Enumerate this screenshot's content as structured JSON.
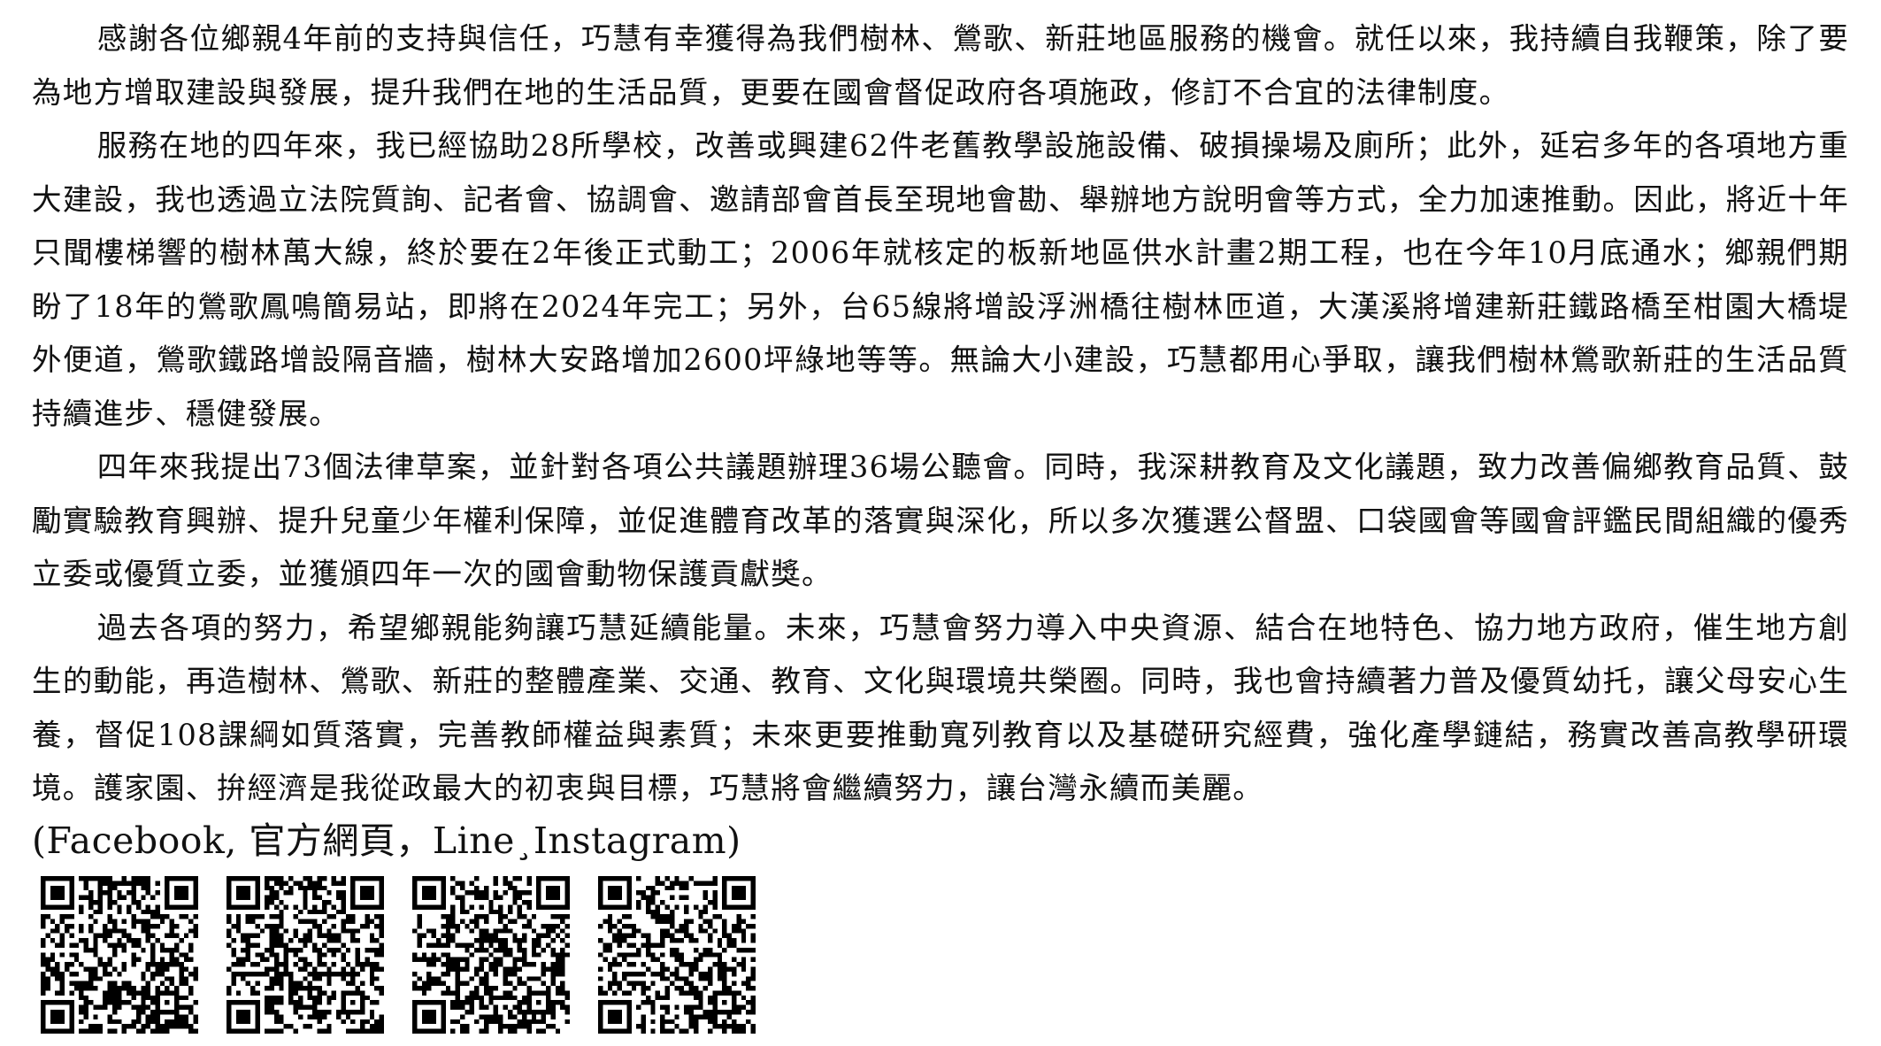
{
  "paragraphs": [
    "感謝各位鄉親4年前的支持與信任，巧慧有幸獲得為我們樹林、鶯歌、新莊地區服務的機會。就任以來，我持續自我鞭策，除了要為地方增取建設與發展，提升我們在地的生活品質，更要在國會督促政府各項施政，修訂不合宜的法律制度。",
    "服務在地的四年來，我已經協助28所學校，改善或興建62件老舊教學設施設備、破損操場及廁所；此外，延宕多年的各項地方重大建設，我也透過立法院質詢、記者會、協調會、邀請部會首長至現地會勘、舉辦地方說明會等方式，全力加速推動。因此，將近十年只聞樓梯響的樹林萬大線，終於要在2年後正式動工；2006年就核定的板新地區供水計畫2期工程，也在今年10月底通水；鄉親們期盼了18年的鶯歌鳳鳴簡易站，即將在2024年完工；另外，台65線將增設浮洲橋往樹林匝道，大漢溪將增建新莊鐵路橋至柑園大橋堤外便道，鶯歌鐵路增設隔音牆，樹林大安路增加2600坪綠地等等。無論大小建設，巧慧都用心爭取，讓我們樹林鶯歌新莊的生活品質持續進步、穩健發展。",
    "四年來我提出73個法律草案，並針對各項公共議題辦理36場公聽會。同時，我深耕教育及文化議題，致力改善偏鄉教育品質、鼓勵實驗教育興辦、提升兒童少年權利保障，並促進體育改革的落實與深化，所以多次獲選公督盟、口袋國會等國會評鑑民間組織的優秀立委或優質立委，並獲頒四年一次的國會動物保護貢獻獎。",
    "過去各項的努力，希望鄉親能夠讓巧慧延續能量。未來，巧慧會努力導入中央資源、結合在地特色、協力地方政府，催生地方創生的動能，再造樹林、鶯歌、新莊的整體產業、交通、教育、文化與環境共榮圈。同時，我也會持續著力普及優質幼托，讓父母安心生養，督促108課綱如質落實，完善教師權益與素質；未來更要推動寬列教育以及基礎研究經費，強化產學鏈結，務實改善高教學研環境。護家園、拚經濟是我從政最大的初衷與目標，巧慧將會繼續努力，讓台灣永續而美麗。"
  ],
  "links_line": "(Facebook, 官方網頁，Line¸Instagram)",
  "qr_codes": [
    "facebook-qr",
    "official-site-qr",
    "line-qr",
    "instagram-qr"
  ],
  "colors": {
    "text": "#111111",
    "qr": "#000000",
    "background": "#ffffff"
  }
}
